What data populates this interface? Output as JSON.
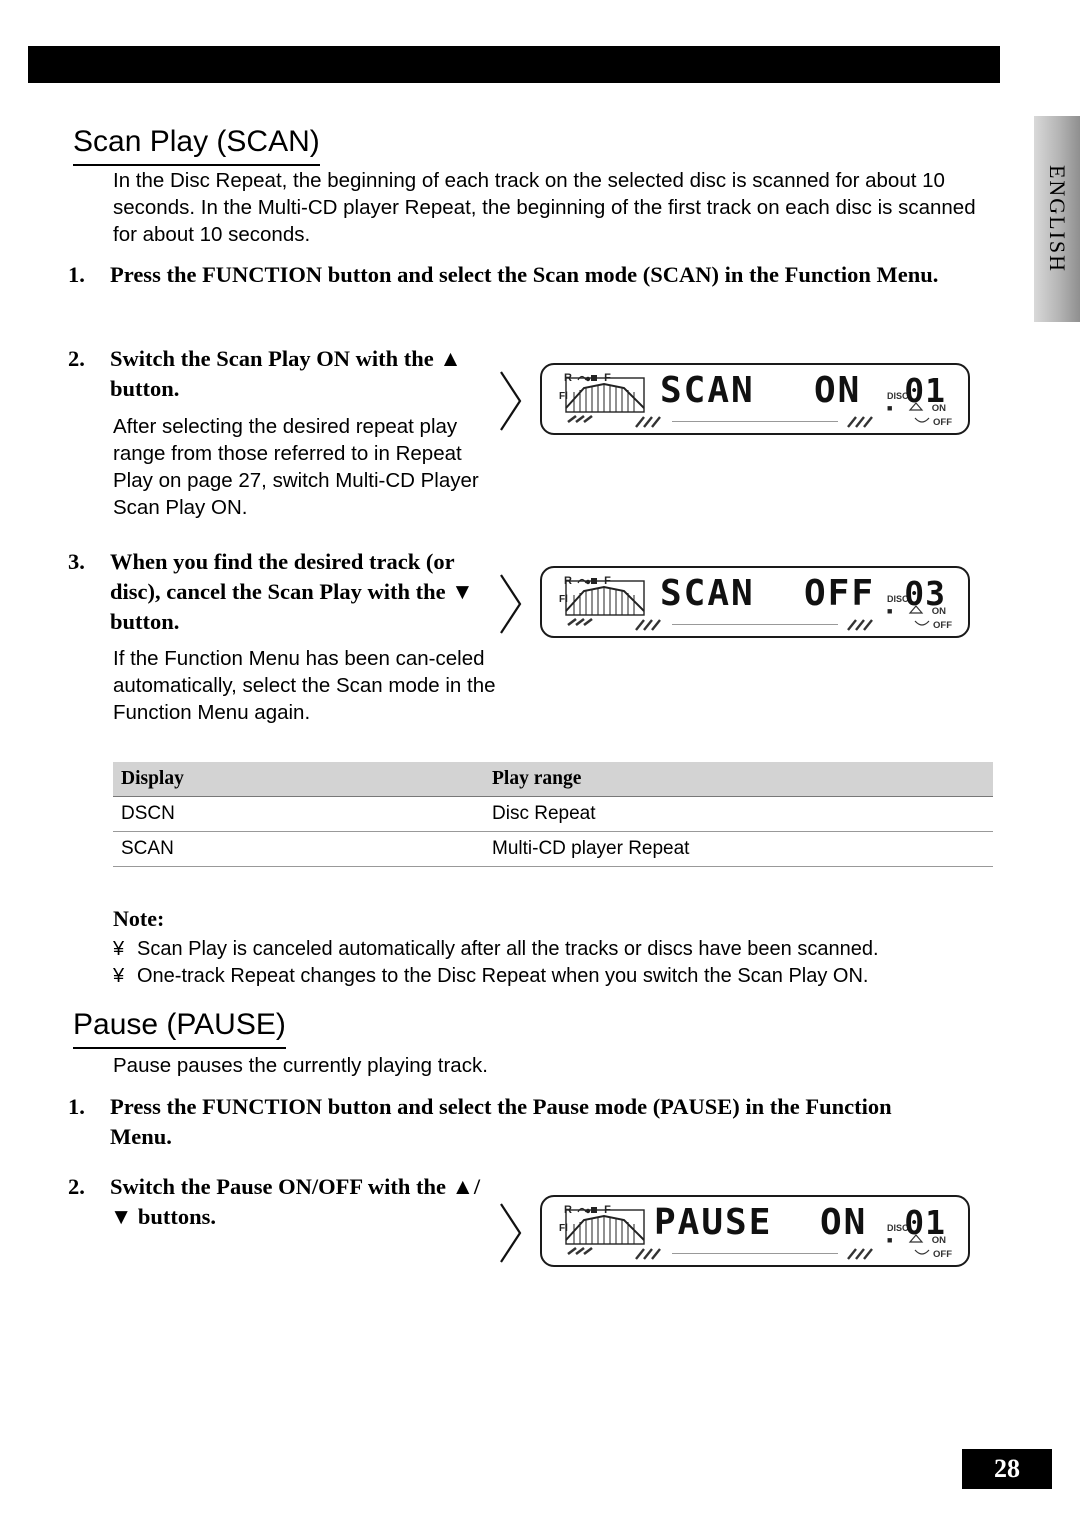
{
  "page": {
    "number": "28",
    "side_tab": "ENGLISH"
  },
  "sections": [
    {
      "title": "Scan Play (SCAN)",
      "intro": "In the Disc Repeat, the beginning of each track on the selected disc is scanned for about 10 seconds. In the Multi-CD player Repeat, the beginning of the first track on each disc is scanned for about 10 seconds.",
      "steps": [
        {
          "num": "1.",
          "text": "Press the FUNCTION button and select the Scan mode (SCAN) in the Function Menu."
        },
        {
          "num": "2.",
          "text": "Switch the Scan Play ON with the ▲ button.",
          "sub": "After selecting the desired repeat play range from those referred to in  Repeat Play  on page 27, switch Multi-CD Player Scan Play ON."
        },
        {
          "num": "3.",
          "text": "When you find the desired track (or disc), cancel the Scan Play with the ▼ button.",
          "sub": "If the Function Menu has been can-celed automatically, select the Scan mode in the Function Menu again."
        }
      ]
    },
    {
      "title": "Pause (PAUSE)",
      "intro": "Pause pauses the currently playing track.",
      "steps": [
        {
          "num": "1.",
          "text": "Press the FUNCTION button and select the Pause mode (PAUSE) in the Function Menu."
        },
        {
          "num": "2.",
          "text": "Switch the Pause ON/OFF with the ▲/▼ buttons."
        }
      ]
    }
  ],
  "lcds": [
    {
      "id": "lcd-scan-on",
      "main": "SCAN",
      "mode": "ON",
      "disc_label": "DISC",
      "number": "01",
      "on_label": "ON",
      "off_label": "OFF",
      "left_marks": "R  F",
      "fl_label": "Fl"
    },
    {
      "id": "lcd-scan-off",
      "main": "SCAN",
      "mode": "OFF",
      "disc_label": "DISC",
      "number": "03",
      "on_label": "ON",
      "off_label": "OFF",
      "left_marks": "R  F",
      "fl_label": "Fl"
    },
    {
      "id": "lcd-pause-on",
      "main": "PAUSE",
      "mode": "ON",
      "disc_label": "DISC",
      "number": "01",
      "on_label": "ON",
      "off_label": "OFF",
      "left_marks": "R  F",
      "fl_label": "Fl"
    }
  ],
  "table": {
    "headers": [
      "Display",
      "Play range"
    ],
    "rows": [
      [
        "DSCN",
        "Disc Repeat"
      ],
      [
        "SCAN",
        "Multi-CD player Repeat"
      ]
    ]
  },
  "note": {
    "heading": "Note:",
    "bullet": "¥",
    "lines": [
      "Scan Play is canceled automatically after all the tracks or discs have been scanned.",
      "One-track Repeat changes to the Disc Repeat when you switch the Scan Play ON."
    ]
  }
}
